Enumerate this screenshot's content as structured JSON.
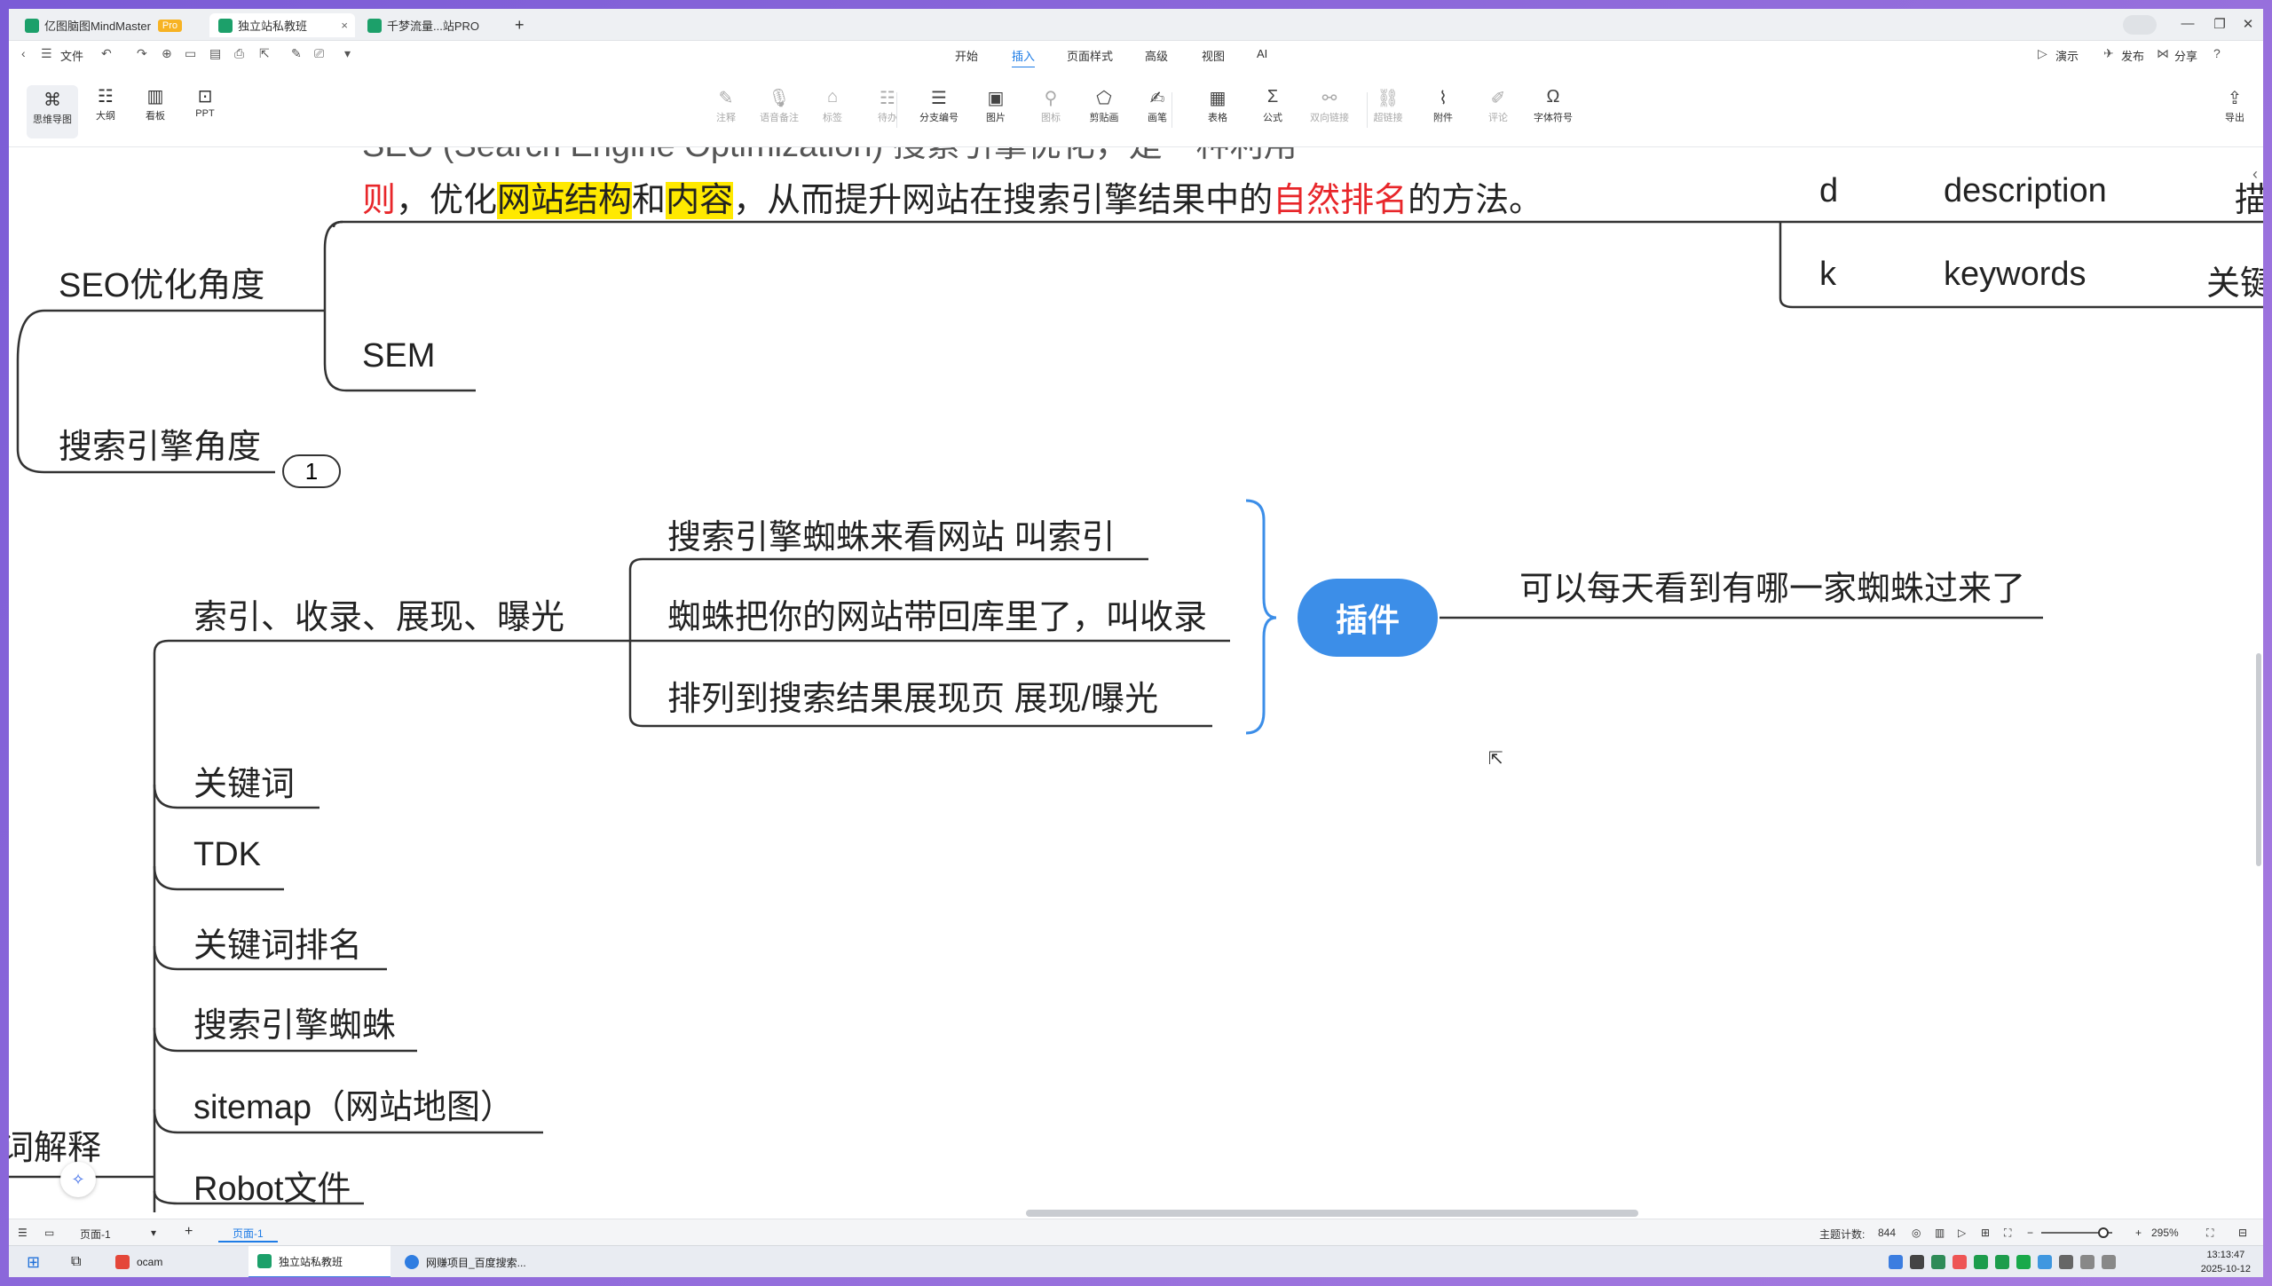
{
  "titlebar": {
    "tabs": [
      {
        "label": "亿图脑图MindMaster",
        "badge": "Pro"
      },
      {
        "label": "独立站私教班"
      },
      {
        "label": "千梦流量...站PRO"
      }
    ],
    "new_tab": "+",
    "win_min": "—",
    "win_max": "❐",
    "win_close": "✕"
  },
  "menubar": {
    "file": "文件",
    "items": [
      "开始",
      "插入",
      "页面样式",
      "高级",
      "视图",
      "AI"
    ],
    "active": "插入",
    "right": [
      "演示",
      "发布",
      "分享"
    ]
  },
  "ribbon": {
    "views": [
      "思维导图",
      "大纲",
      "看板",
      "PPT"
    ],
    "tools": [
      {
        "label": "注释",
        "icon": "✎",
        "dim": true
      },
      {
        "label": "语音备注",
        "icon": "🎙",
        "dim": true
      },
      {
        "label": "标签",
        "icon": "⌂",
        "dim": true
      },
      {
        "label": "待办",
        "icon": "☷",
        "dim": true
      },
      {
        "label": "分支编号",
        "icon": "☰",
        "dim": false
      },
      {
        "label": "图片",
        "icon": "▣",
        "dim": false
      },
      {
        "label": "图标",
        "icon": "⚲",
        "dim": true
      },
      {
        "label": "剪贴画",
        "icon": "⬠",
        "dim": false
      },
      {
        "label": "画笔",
        "icon": "✍",
        "dim": false
      },
      {
        "label": "表格",
        "icon": "▦",
        "dim": false
      },
      {
        "label": "公式",
        "icon": "Σ",
        "dim": false
      },
      {
        "label": "双向链接",
        "icon": "⚯",
        "dim": true
      },
      {
        "label": "超链接",
        "icon": "⛓",
        "dim": true
      },
      {
        "label": "附件",
        "icon": "⌇",
        "dim": false
      },
      {
        "label": "评论",
        "icon": "✐",
        "dim": true
      },
      {
        "label": "字体符号",
        "icon": "Ω",
        "dim": false
      }
    ],
    "export": "导出"
  },
  "map": {
    "intro_line1_prefix": "SEO (Search Engine Optimization) 搜索引擎优化，是一种利用",
    "intro_line2": {
      "a": "则",
      "b": "，优化",
      "c": "网站结构",
      "d": "和",
      "e": "内容",
      "f": "，从而提升网站在搜索引擎结果中的",
      "g": "自然排名",
      "h": "的方法。"
    },
    "seo_angle": "SEO优化角度",
    "sem": "SEM",
    "search_angle": "搜索引擎角度",
    "collapsed_count": "1",
    "tdk_table": [
      {
        "k": "d",
        "v": "description",
        "extra": "描"
      },
      {
        "k": "k",
        "v": "keywords",
        "extra": "关键"
      }
    ],
    "index_topic": "索引、收录、展现、曝光",
    "index_children": [
      "搜索引擎蜘蛛来看网站  叫索引",
      "蜘蛛把你的网站带回库里了，叫收录",
      "排列到搜索结果展现页   展现/曝光"
    ],
    "plugin": "插件",
    "plugin_note": "可以每天看到有哪一家蜘蛛过来了",
    "terms": [
      "关键词",
      "TDK",
      "关键词排名",
      "搜索引擎蜘蛛",
      "sitemap（网站地图）",
      "Robot文件"
    ],
    "left_label": "词解释"
  },
  "statusbar": {
    "page_select": "页面-1",
    "page_tab": "页面-1",
    "topic_count_label": "主题计数:",
    "topic_count": "844",
    "zoom": "295%"
  },
  "taskbar": {
    "items": [
      "ocam",
      "独立站私教班",
      "网赚项目_百度搜索..."
    ],
    "time": "13:13:47",
    "date": "2025-10-12"
  }
}
